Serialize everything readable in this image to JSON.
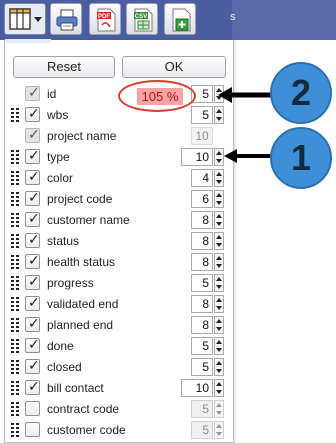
{
  "toolbar": {
    "partial_text": "s",
    "buttons": [
      {
        "name": "columns",
        "icon": "columns-icon"
      },
      {
        "name": "print",
        "icon": "printer-icon"
      },
      {
        "name": "pdf",
        "icon": "pdf-icon",
        "text": "PDF"
      },
      {
        "name": "csv",
        "icon": "csv-icon",
        "text": "CSV"
      },
      {
        "name": "excel",
        "icon": "excel-plus-icon"
      }
    ]
  },
  "panel": {
    "reset_label": "Reset",
    "ok_label": "OK",
    "columns": [
      {
        "label": "id",
        "checked": true,
        "locked": true,
        "width": "5",
        "width_editable": true
      },
      {
        "label": "wbs",
        "checked": true,
        "locked": false,
        "width": "5",
        "width_editable": true
      },
      {
        "label": "project name",
        "checked": true,
        "locked": true,
        "width": "10",
        "width_editable": false
      },
      {
        "label": "type",
        "checked": true,
        "locked": false,
        "width": "10",
        "width_editable": true
      },
      {
        "label": "color",
        "checked": true,
        "locked": false,
        "width": "4",
        "width_editable": true
      },
      {
        "label": "project code",
        "checked": true,
        "locked": false,
        "width": "6",
        "width_editable": true
      },
      {
        "label": "customer name",
        "checked": true,
        "locked": false,
        "width": "8",
        "width_editable": true
      },
      {
        "label": "status",
        "checked": true,
        "locked": false,
        "width": "8",
        "width_editable": true
      },
      {
        "label": "health status",
        "checked": true,
        "locked": false,
        "width": "8",
        "width_editable": true
      },
      {
        "label": "progress",
        "checked": true,
        "locked": false,
        "width": "5",
        "width_editable": true
      },
      {
        "label": "validated end",
        "checked": true,
        "locked": false,
        "width": "8",
        "width_editable": true
      },
      {
        "label": "planned end",
        "checked": true,
        "locked": false,
        "width": "8",
        "width_editable": true
      },
      {
        "label": "done",
        "checked": true,
        "locked": false,
        "width": "5",
        "width_editable": true
      },
      {
        "label": "closed",
        "checked": true,
        "locked": false,
        "width": "5",
        "width_editable": true
      },
      {
        "label": "bill contact",
        "checked": true,
        "locked": false,
        "width": "10",
        "width_editable": true
      },
      {
        "label": "contract code",
        "checked": false,
        "locked": false,
        "width": "5",
        "width_editable": true
      },
      {
        "label": "customer code",
        "checked": false,
        "locked": false,
        "width": "5",
        "width_editable": true
      }
    ]
  },
  "annotations": {
    "zoom_text": "105 %",
    "callouts": [
      "2",
      "1"
    ],
    "ellipse_color": "#e03a2e",
    "badge_color": "#3f8fd8"
  }
}
